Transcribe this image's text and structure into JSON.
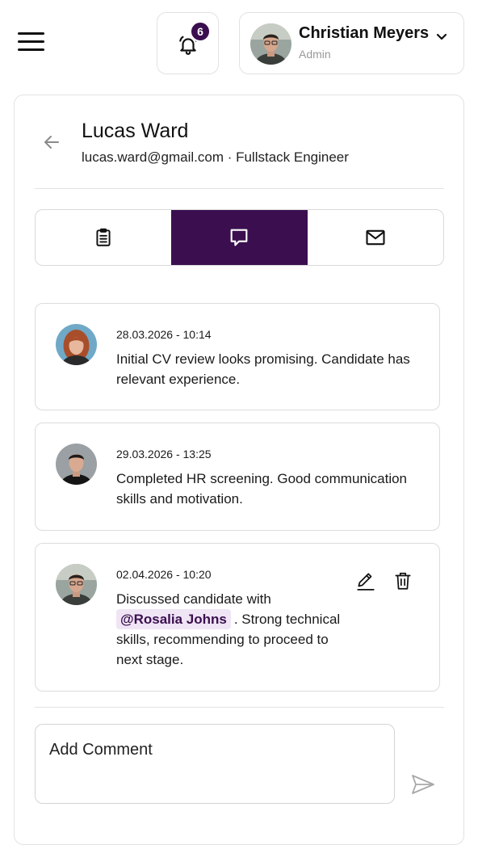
{
  "header": {
    "notification_count": "6",
    "user": {
      "name": "Christian Meyers",
      "role": "Admin"
    }
  },
  "candidate": {
    "name": "Lucas Ward",
    "subtitle": "lucas.ward@gmail.com · Fullstack Engineer"
  },
  "tabs": [
    {
      "icon": "clipboard-icon",
      "active": false
    },
    {
      "icon": "comment-icon",
      "active": true
    },
    {
      "icon": "mail-icon",
      "active": false
    }
  ],
  "comments": [
    {
      "date": "28.03.2026 - 10:14",
      "text": "Initial CV review looks promising. Candidate has relevant experience."
    },
    {
      "date": "29.03.2026 - 13:25",
      "text": "Completed HR screening. Good communication skills and motivation."
    },
    {
      "date": "02.04.2026 - 10:20",
      "text_before": "Discussed candidate with",
      "mention": "@Rosalia Johns",
      "text_after": ". Strong technical skills, recommending to proceed to next stage."
    }
  ],
  "composer": {
    "placeholder": "Add Comment"
  },
  "colors": {
    "accent": "#3b0f4f",
    "mention_bg": "#efe5f5",
    "border": "#e2e2e2"
  }
}
